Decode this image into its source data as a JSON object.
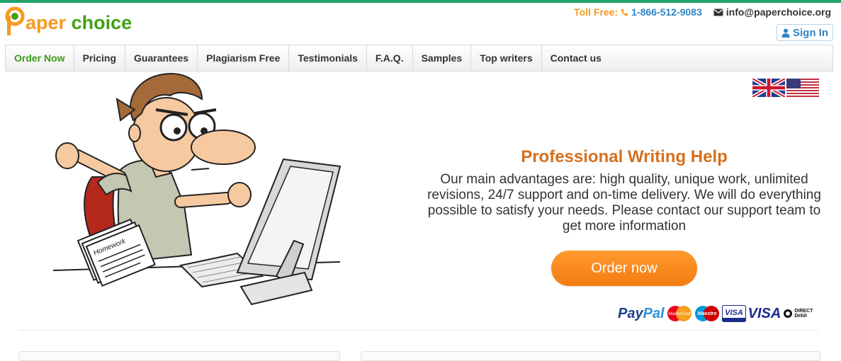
{
  "brand": {
    "logo_part1": "aper",
    "logo_part2": "choice",
    "accent": "#f59a1e",
    "green": "#43a014"
  },
  "contact": {
    "toll_free_label": "Toll Free:",
    "phone": "1-866-512-9083",
    "phone_icon": "phone-icon",
    "email": "info@paperchoice.org",
    "email_icon": "envelope-icon"
  },
  "signin": {
    "label": "Sign In",
    "icon": "user-icon"
  },
  "nav": {
    "items": [
      {
        "label": "Order Now"
      },
      {
        "label": "Pricing"
      },
      {
        "label": "Guarantees"
      },
      {
        "label": "Plagiarism Free"
      },
      {
        "label": "Testimonials"
      },
      {
        "label": "F.A.Q."
      },
      {
        "label": "Samples"
      },
      {
        "label": "Top writers"
      },
      {
        "label": "Contact us"
      }
    ],
    "active_color": "#3b9a1a"
  },
  "flags": {
    "uk_icon": "uk-flag-icon",
    "us_icon": "us-flag-icon"
  },
  "hero": {
    "title": "Professional Writing Help",
    "description": "Our main advantages are: high quality, unique work, unlimited revisions, 24/7 support and on-time delivery. We will do everything possible to satisfy your needs. Please contact our support team to get more information",
    "cta": "Order now",
    "illustration_label": "Homework",
    "title_color": "#d5701d",
    "cta_color": "#f47c12"
  },
  "payments": {
    "paypal_part1": "Pay",
    "paypal_part2": "Pal",
    "mastercard": "MasterCard",
    "maestro": "Maestro",
    "visa_electron": "VISA",
    "visa": "VISA",
    "direct_debit_line1": "DIRECT",
    "direct_debit_line2": "Debit"
  }
}
